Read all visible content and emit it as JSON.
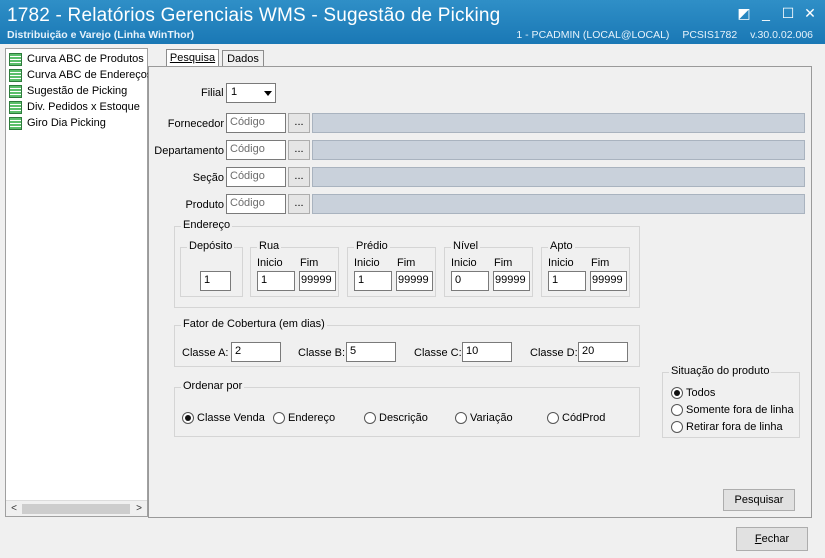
{
  "window": {
    "title": "1782 - Relatórios Gerenciais WMS - Sugestão de Picking",
    "subtitle": "Distribuição e Varejo (Linha WinThor)",
    "session": "1 - PCADMIN (LOCAL@LOCAL)",
    "program": "PCSIS1782",
    "version": "v.30.0.02.006"
  },
  "sidebar": {
    "items": [
      {
        "label": "Curva ABC de Produtos"
      },
      {
        "label": "Curva ABC de Endereços"
      },
      {
        "label": "Sugestão de Picking"
      },
      {
        "label": "Div. Pedidos x Estoque"
      },
      {
        "label": "Giro Dia Picking"
      }
    ]
  },
  "tabs": [
    {
      "label": "Pesquisa"
    },
    {
      "label": "Dados"
    }
  ],
  "form": {
    "filial": {
      "label": "Filial",
      "value": "1"
    },
    "fornecedor": {
      "label": "Fornecedor",
      "placeholder": "Código"
    },
    "departamento": {
      "label": "Departamento",
      "placeholder": "Código"
    },
    "secao": {
      "label": "Seção",
      "placeholder": "Código"
    },
    "produto": {
      "label": "Produto",
      "placeholder": "Código"
    },
    "ellipsis": "..."
  },
  "endereco": {
    "title": "Endereço",
    "deposito": {
      "label": "Depósito",
      "value": "1"
    },
    "rua": {
      "label": "Rua",
      "inicio_label": "Inicio",
      "fim_label": "Fim",
      "inicio": "1",
      "fim": "99999"
    },
    "predio": {
      "label": "Prédio",
      "inicio_label": "Inicio",
      "fim_label": "Fim",
      "inicio": "1",
      "fim": "99999"
    },
    "nivel": {
      "label": "Nível",
      "inicio_label": "Inicio",
      "fim_label": "Fim",
      "inicio": "0",
      "fim": "99999"
    },
    "apto": {
      "label": "Apto",
      "inicio_label": "Inicio",
      "fim_label": "Fim",
      "inicio": "1",
      "fim": "99999"
    }
  },
  "cobertura": {
    "title": "Fator de Cobertura (em dias)",
    "a": {
      "label": "Classe A:",
      "value": "2"
    },
    "b": {
      "label": "Classe B:",
      "value": "5"
    },
    "c": {
      "label": "Classe C:",
      "value": "10"
    },
    "d": {
      "label": "Classe D:",
      "value": "20"
    }
  },
  "ordenar": {
    "title": "Ordenar por",
    "options": [
      {
        "label": "Classe Venda",
        "selected": true
      },
      {
        "label": "Endereço",
        "selected": false
      },
      {
        "label": "Descrição",
        "selected": false
      },
      {
        "label": "Variação",
        "selected": false
      },
      {
        "label": "CódProd",
        "selected": false
      }
    ]
  },
  "situacao": {
    "title": "Situação do produto",
    "options": [
      {
        "label": "Todos",
        "selected": true
      },
      {
        "label": "Somente fora de linha",
        "selected": false
      },
      {
        "label": "Retirar fora de linha",
        "selected": false
      }
    ]
  },
  "buttons": {
    "pesquisar": "Pesquisar",
    "fechar_first": "F",
    "fechar_rest": "echar"
  }
}
